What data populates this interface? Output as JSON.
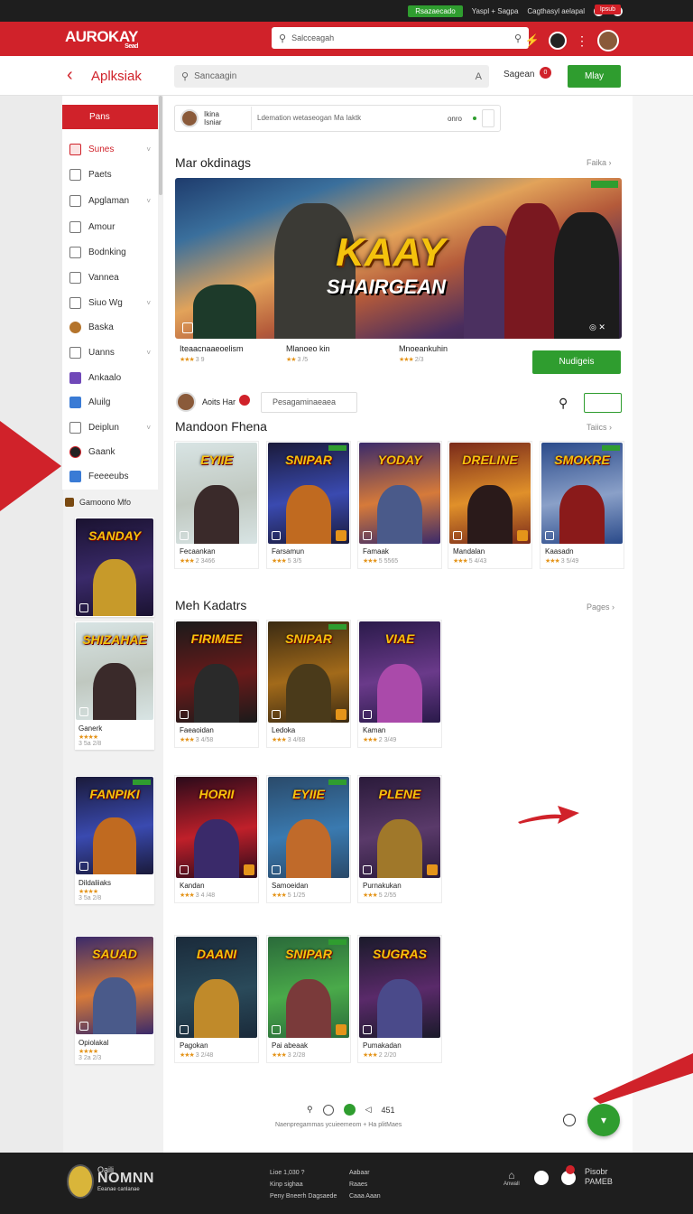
{
  "topbar": {
    "pill": "Rsazaecado",
    "t1": "Yaspl + Sagpa",
    "t2": "Cagthasyl aelapal",
    "badge": "Ipsub"
  },
  "brand": {
    "logo": "AUROKAY",
    "tag": "Sead"
  },
  "redsearch": {
    "placeholder": "Salcceagah"
  },
  "subheader": {
    "back": "‹",
    "title": "Aplksiak",
    "search": "Sancaagin",
    "sign": "Sagean",
    "notif": "0",
    "button": "Mlay"
  },
  "sidebar": {
    "active": "Pans",
    "items": [
      {
        "label": "Sunes",
        "chev": "˅",
        "style": "r"
      },
      {
        "label": "Paets",
        "chev": "",
        "style": ""
      },
      {
        "label": "Apglaman",
        "chev": "˅",
        "style": ""
      },
      {
        "label": "Amour",
        "chev": "",
        "style": ""
      },
      {
        "label": "Bodnking",
        "chev": "",
        "style": ""
      },
      {
        "label": "Vannea",
        "chev": "",
        "style": ""
      },
      {
        "label": "Siuo Wg",
        "chev": "˅",
        "style": ""
      },
      {
        "label": "Baska",
        "chev": "",
        "style": "o"
      },
      {
        "label": "Uanns",
        "chev": "˅",
        "style": ""
      },
      {
        "label": "Ankaalo",
        "chev": "",
        "style": "p"
      },
      {
        "label": "Aluilg",
        "chev": "",
        "style": "b"
      },
      {
        "label": "Deiplun",
        "chev": "˅",
        "style": ""
      },
      {
        "label": "Gaank",
        "chev": "",
        "style": "k"
      },
      {
        "label": "Feeeeubs",
        "chev": "",
        "style": "b"
      }
    ],
    "featured_title": "Gamoono Mfo",
    "cards": [
      {
        "title": "SANDAY",
        "name": "",
        "rating": ""
      },
      {
        "title": "SHIZAHAE",
        "name": "Ganerk",
        "rating": "3 5a 2/8"
      },
      {
        "title": "FANPIKI",
        "name": "Dildaliiaks",
        "rating": "3 5a 2/8"
      },
      {
        "title": "SAUAD",
        "name": "Opiolakal",
        "rating": "3 2a 2/3"
      }
    ]
  },
  "composer": {
    "name1": "Ikina",
    "name2": "Isniar",
    "placeholder": "Ldemation wetaseogan Ma Iaktk",
    "count": "onro"
  },
  "section1": {
    "title": "Mar okdinags",
    "link": "Faika ›"
  },
  "hero": {
    "line1": "KAAY",
    "line2": "SHAIRGEAN",
    "games": [
      {
        "name": "Iteaacnaaeoelism",
        "rating": "3 9"
      },
      {
        "name": "Mlanoeo kin",
        "rating": "3 /5"
      },
      {
        "name": "Mnoeankuhin",
        "rating": "2/3"
      }
    ],
    "button": "Nudigeis"
  },
  "filterrow": {
    "name": "Aoits Har",
    "search": "Pesagaminaeaea"
  },
  "section2": {
    "title": "Mandoon Fhena",
    "link": "Taiics ›",
    "cards": [
      {
        "title": "EYIIE",
        "name": "Fecaankan",
        "rating": "2 3466"
      },
      {
        "title": "SNIPAR",
        "name": "Farsamun",
        "rating": "5 3/5"
      },
      {
        "title": "YODAY",
        "name": "Famaak",
        "rating": "5 5565"
      },
      {
        "title": "DRELINE",
        "name": "Mandalan",
        "rating": "5 4/43"
      },
      {
        "title": "SMOKRE",
        "name": "Kaasadn",
        "rating": "3 5/49"
      }
    ]
  },
  "section3": {
    "title": "Meh Kadatrs",
    "link": "Pages ›",
    "cards": [
      {
        "title": "FIRIMEE",
        "name": "Faeaoidan",
        "rating": "3 4/58"
      },
      {
        "title": "SNIPAR",
        "name": "Ledoka",
        "rating": "3 4/68"
      },
      {
        "title": "VIAE",
        "name": "Kaman",
        "rating": "2 3/49"
      },
      {
        "title": "HORII",
        "name": "Kandan",
        "rating": "3 4 /48"
      },
      {
        "title": "EYIIE",
        "name": "Samoeidan",
        "rating": "5 1/25"
      },
      {
        "title": "PLENE",
        "name": "Purnakukan",
        "rating": "5 2/55"
      },
      {
        "title": "DAANI",
        "name": "Pagokan",
        "rating": "3 2/48"
      },
      {
        "title": "SNIPAR",
        "name": "Pai abeaak",
        "rating": "3 2/28"
      },
      {
        "title": "SUGRAS",
        "name": "Pumakadan",
        "rating": "2 2/20"
      }
    ]
  },
  "pager": {
    "page": "451",
    "note": "Naenpregammas ycuieemeom + Ha plitMaes"
  },
  "footer": {
    "logo_l1": "Oaili",
    "logo_l2": "NOMNN",
    "logo_l3": "Eeanae canlanae",
    "col1": [
      "Lioe 1,030  ?",
      "Kinp sighaa",
      "Peny Bneerh Dagsaede"
    ],
    "col2": [
      "Aabaar",
      "Raaes",
      "Caaa Aaan"
    ],
    "amu": "Anwall",
    "r1": "Pisobr",
    "r2": "PAMEB"
  },
  "colors": {
    "accent": "#d0222a",
    "green": "#2f9d2f",
    "dark": "#1e1e1e"
  }
}
